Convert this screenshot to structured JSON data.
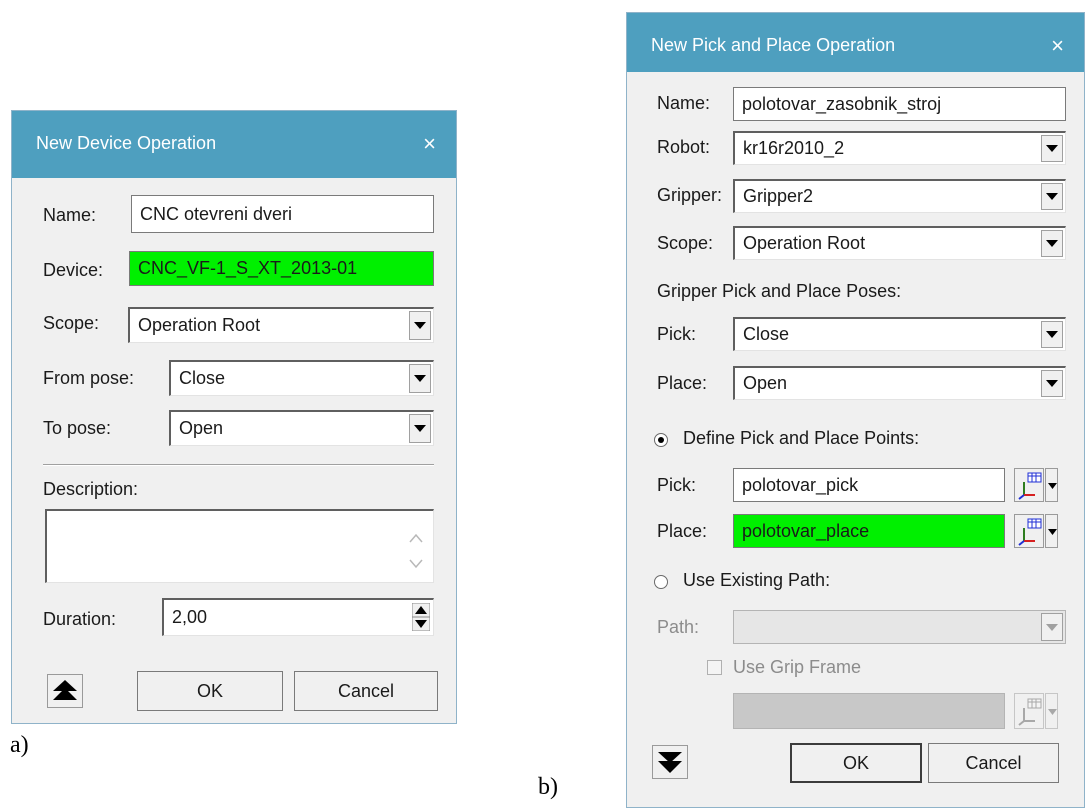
{
  "figure_labels": {
    "a": "a)",
    "b": "b)"
  },
  "device_dialog": {
    "title": "New Device Operation",
    "close_glyph": "×",
    "name_label": "Name:",
    "name_value": "CNC otevreni dveri",
    "device_label": "Device:",
    "device_value": "CNC_VF-1_S_XT_2013-01",
    "scope_label": "Scope:",
    "scope_value": "Operation Root",
    "from_pose_label": "From pose:",
    "from_pose_value": "Close",
    "to_pose_label": "To pose:",
    "to_pose_value": "Open",
    "description_label": "Description:",
    "description_value": "",
    "duration_label": "Duration:",
    "duration_value": "2,00",
    "ok_label": "OK",
    "cancel_label": "Cancel"
  },
  "pick_dialog": {
    "title": "New Pick and Place Operation",
    "close_glyph": "×",
    "name_label": "Name:",
    "name_value": "polotovar_zasobnik_stroj",
    "robot_label": "Robot:",
    "robot_value": "kr16r2010_2",
    "gripper_label": "Gripper:",
    "gripper_value": "Gripper2",
    "scope_label": "Scope:",
    "scope_value": "Operation Root",
    "poses_heading": "Gripper Pick and Place Poses:",
    "pick_pose_label": "Pick:",
    "pick_pose_value": "Close",
    "place_pose_label": "Place:",
    "place_pose_value": "Open",
    "define_points_label": "Define Pick and Place Points:",
    "pick_point_label": "Pick:",
    "pick_point_value": "polotovar_pick",
    "place_point_label": "Place:",
    "place_point_value": "polotovar_place",
    "use_path_label": "Use Existing Path:",
    "path_label": "Path:",
    "path_value": "",
    "grip_frame_label": "Use Grip Frame",
    "grip_frame_value": "",
    "ok_label": "OK",
    "cancel_label": "Cancel"
  },
  "colors": {
    "titlebar": "#4e9fbf",
    "selected_field": "#00f000"
  }
}
